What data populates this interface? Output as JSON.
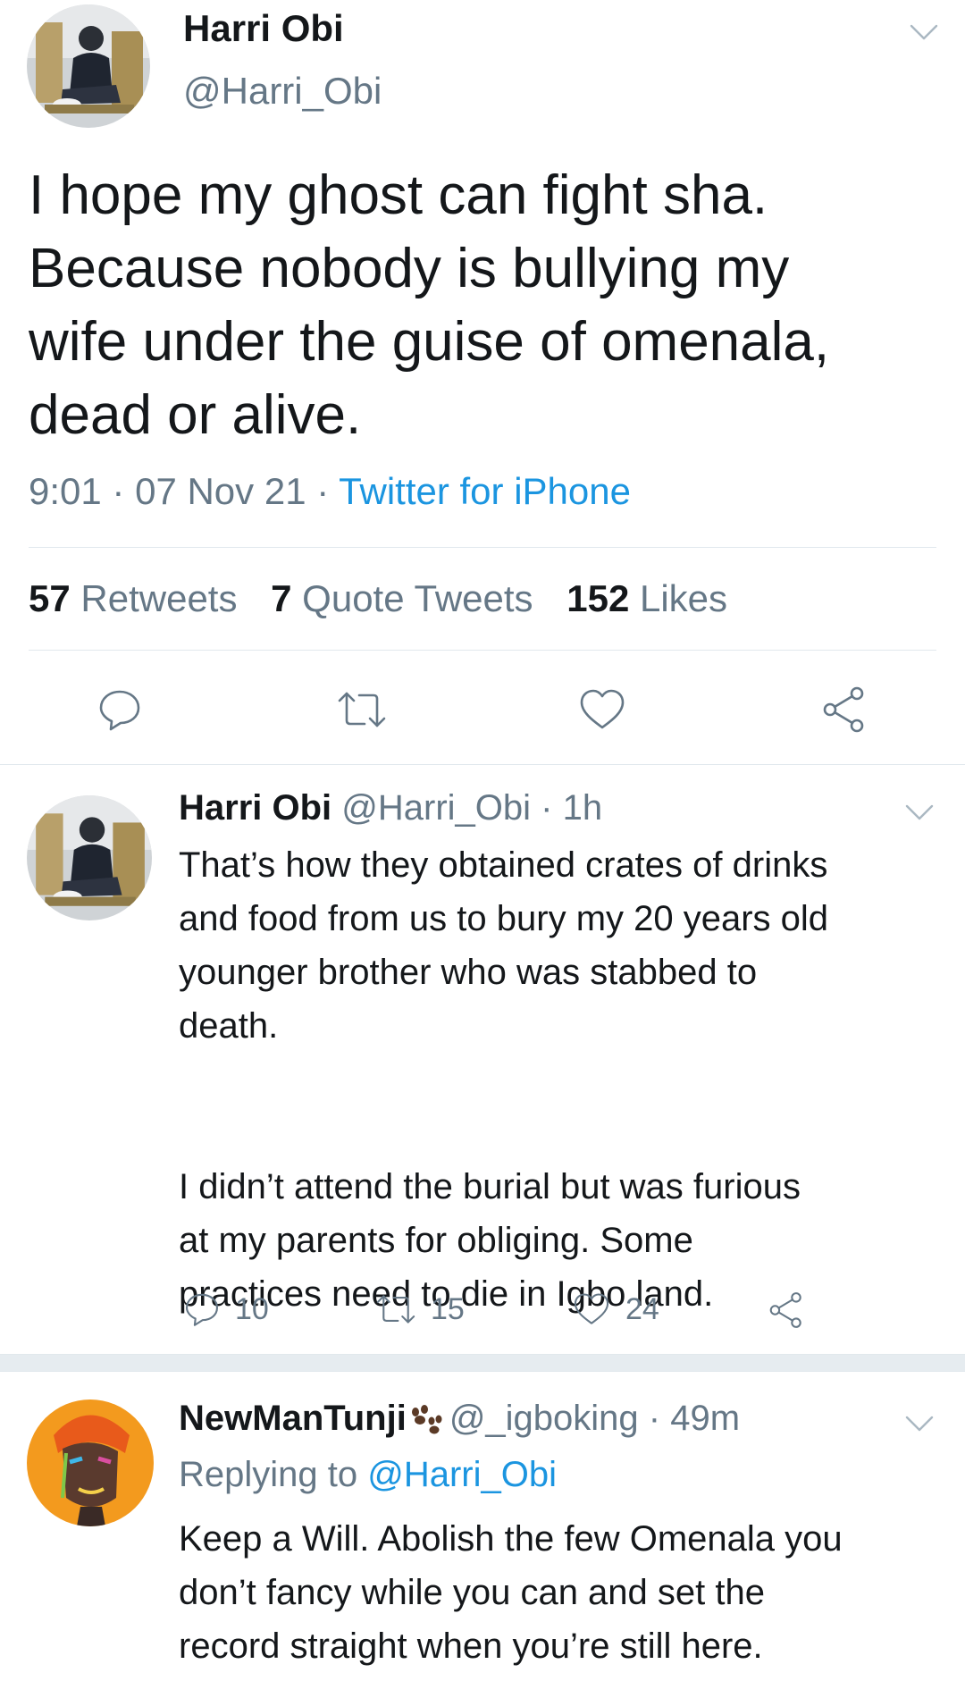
{
  "main_tweet": {
    "name": "Harri Obi",
    "handle": "@Harri_Obi",
    "text_lines": [
      "I hope my ghost can fight sha.",
      "Because nobody is bullying my",
      "wife under the guise of omenala,",
      "dead or alive."
    ],
    "time": "9:01",
    "sep1": "·",
    "date": "07 Nov 21",
    "sep2": "·",
    "source": "Twitter for iPhone",
    "retweets_count": "57",
    "retweets_label": "Retweets",
    "quotes_count": "7",
    "quotes_label": "Quote Tweets",
    "likes_count": "152",
    "likes_label": "Likes"
  },
  "reply1": {
    "name": "Harri Obi",
    "handle": "@Harri_Obi",
    "time": "· 1h",
    "text_lines": [
      "That’s how they obtained crates of drinks",
      "and food from us to bury my 20 years old",
      "younger brother who was stabbed to",
      "death.",
      "",
      "I didn’t attend the burial but was furious",
      "at my parents for obliging. Some",
      "practices need to die in Igbo land."
    ],
    "reply_count": "10",
    "retweet_count": "15",
    "like_count": "24"
  },
  "reply2": {
    "name": "NewManTunji",
    "handle": "@_igboking",
    "time": "· 49m",
    "replying_prefix": "Replying to",
    "replying_to": "@Harri_Obi",
    "text_lines": [
      "Keep a Will. Abolish the few Omenala you",
      "don’t fancy while you can and set the",
      "record straight when you’re still here."
    ]
  },
  "colors": {
    "text": "#14171a",
    "muted": "#657786",
    "link": "#1b95e0",
    "divider": "#e1e8ed"
  },
  "icons": [
    "chevron-down-icon",
    "reply-icon",
    "retweet-icon",
    "like-icon",
    "share-icon",
    "paw-emoji-icon"
  ]
}
